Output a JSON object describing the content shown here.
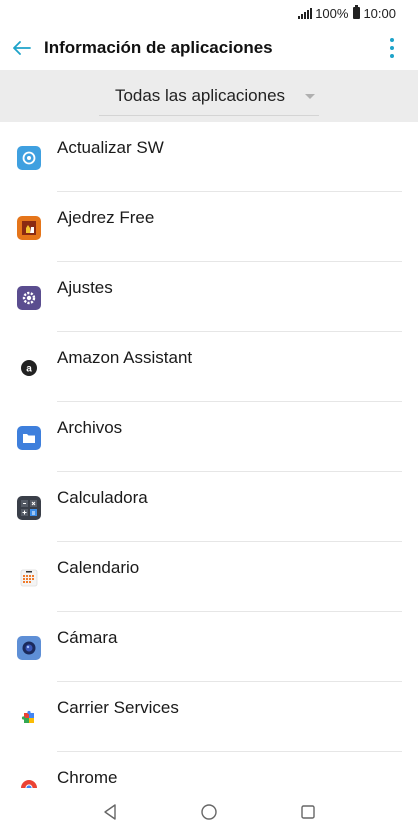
{
  "status": {
    "battery": "100%",
    "time": "10:00"
  },
  "header": {
    "title": "Información de aplicaciones"
  },
  "filter": {
    "selected": "Todas las aplicaciones"
  },
  "apps": [
    {
      "name": "Actualizar SW",
      "icon": "update-icon",
      "color": "#3fa0e0"
    },
    {
      "name": "Ajedrez Free",
      "icon": "chess-icon",
      "color": "#e5751a"
    },
    {
      "name": "Ajustes",
      "icon": "settings-gear-icon",
      "color": "#5a4d8f"
    },
    {
      "name": "Amazon Assistant",
      "icon": "amazon-icon",
      "color": "#ffffff"
    },
    {
      "name": "Archivos",
      "icon": "folder-icon",
      "color": "#3e7fdc"
    },
    {
      "name": "Calculadora",
      "icon": "calculator-icon",
      "color": "#3a3f49"
    },
    {
      "name": "Calendario",
      "icon": "calendar-icon",
      "color": "#ffffff"
    },
    {
      "name": "Cámara",
      "icon": "camera-icon",
      "color": "#5e8fd6"
    },
    {
      "name": "Carrier Services",
      "icon": "puzzle-icon",
      "color": "#ffffff"
    },
    {
      "name": "Chrome",
      "icon": "chrome-icon",
      "color": "#ffffff"
    }
  ],
  "colors": {
    "accent": "#1ea3c9",
    "filter_band": "#ececec"
  }
}
